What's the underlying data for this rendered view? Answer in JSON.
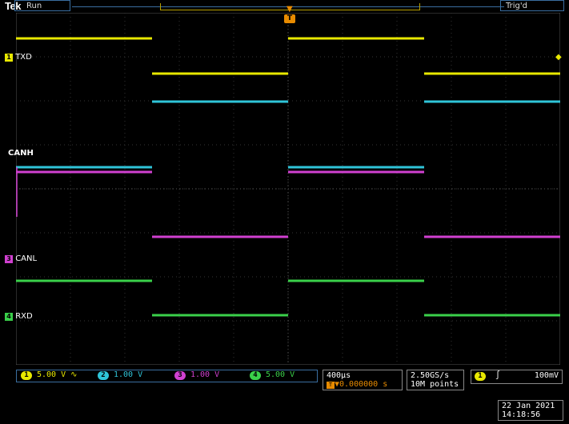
{
  "header": {
    "brand": "Tek",
    "run_state": "Run",
    "trigger_state": "Trig'd"
  },
  "channels": [
    {
      "num": "1",
      "label": "TXD",
      "color": "#e8e800",
      "scale": "5.00 V",
      "coupling": "∿"
    },
    {
      "num": "2",
      "label": "CANH",
      "color": "#2fc4d8",
      "scale": "1.00 V"
    },
    {
      "num": "3",
      "label": "CANL",
      "color": "#d040d0",
      "scale": "1.00 V"
    },
    {
      "num": "4",
      "label": "RXD",
      "color": "#3ad04a",
      "scale": "5.00 V"
    }
  ],
  "timebase": {
    "scale": "400µs",
    "trigger_pos": "▼0.000000 s"
  },
  "acquisition": {
    "sample_rate": "2.50GS/s",
    "record_length": "10M points"
  },
  "trigger": {
    "source": "1",
    "slope": "∫",
    "level": "100mV"
  },
  "date": {
    "day": "22 Jan  2021",
    "time": "14:18:56"
  },
  "waveforms": {
    "TXD": [
      [
        0,
        "high"
      ],
      [
        0.25,
        "low"
      ],
      [
        0.5,
        "high"
      ],
      [
        0.75,
        "low"
      ],
      [
        1,
        "low"
      ]
    ],
    "CANH": [
      [
        0,
        "dominant"
      ],
      [
        0.25,
        "recessive"
      ],
      [
        0.5,
        "dominant"
      ],
      [
        0.75,
        "recessive"
      ],
      [
        1,
        "recessive"
      ]
    ],
    "CANL": [
      [
        0,
        "dominant"
      ],
      [
        0.25,
        "recessive"
      ],
      [
        0.5,
        "dominant"
      ],
      [
        0.75,
        "recessive"
      ],
      [
        1,
        "recessive"
      ]
    ],
    "RXD": [
      [
        0,
        "high"
      ],
      [
        0.25,
        "low"
      ],
      [
        0.5,
        "high"
      ],
      [
        0.75,
        "low"
      ],
      [
        1,
        "low"
      ]
    ]
  }
}
